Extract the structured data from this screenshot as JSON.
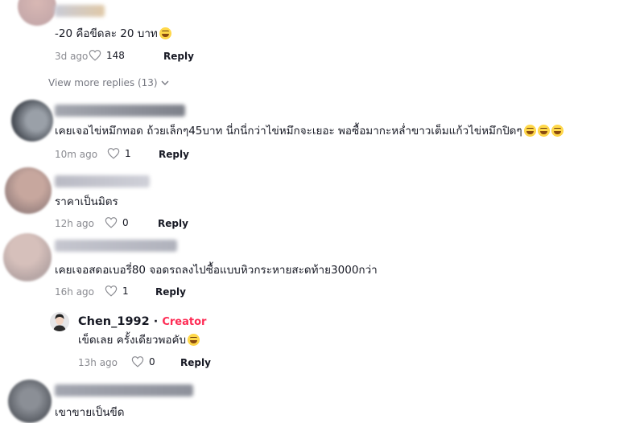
{
  "comments": [
    {
      "text": "-20 คือขีดละ 20 บาท",
      "time": "3d ago",
      "likes": "148",
      "reply_label": "Reply"
    },
    {
      "view_more": "View more replies (13)"
    },
    {
      "text": "เคยเจอไข่หมึกทอด ถ้วยเล็กๆ45บาท นี่กนี่กว่าไข่หมึกจะเยอะ พอซื้อมากะหล่ำขาวเต็มแก้วไข่หมึกปิดๆ",
      "time": "10m ago",
      "likes": "1",
      "reply_label": "Reply"
    },
    {
      "text": "ราคาเป็นมิตร",
      "time": "12h ago",
      "likes": "0",
      "reply_label": "Reply"
    },
    {
      "text": "เคยเจอสดอเบอรี่80 จอดรถลงไปซื้อแบบหิวกระหายสะดท้าย3000กว่า",
      "time": "16h ago",
      "likes": "1",
      "reply_label": "Reply"
    },
    {
      "author": "Chen_1992",
      "separator": " · ",
      "badge": "Creator",
      "text": "เข็ดเลย ครั้งเดียวพอคับ",
      "time": "13h ago",
      "likes": "0",
      "reply_label": "Reply"
    },
    {
      "text": "เขาขายเป็นขีด"
    }
  ],
  "colors": {
    "creator_badge": "#fe2c55",
    "meta_gray": "#8a8b91"
  },
  "icons": {
    "like": "heart-outline-icon",
    "expand": "chevron-down-icon",
    "emoji": "sweat-smile-emoji"
  }
}
